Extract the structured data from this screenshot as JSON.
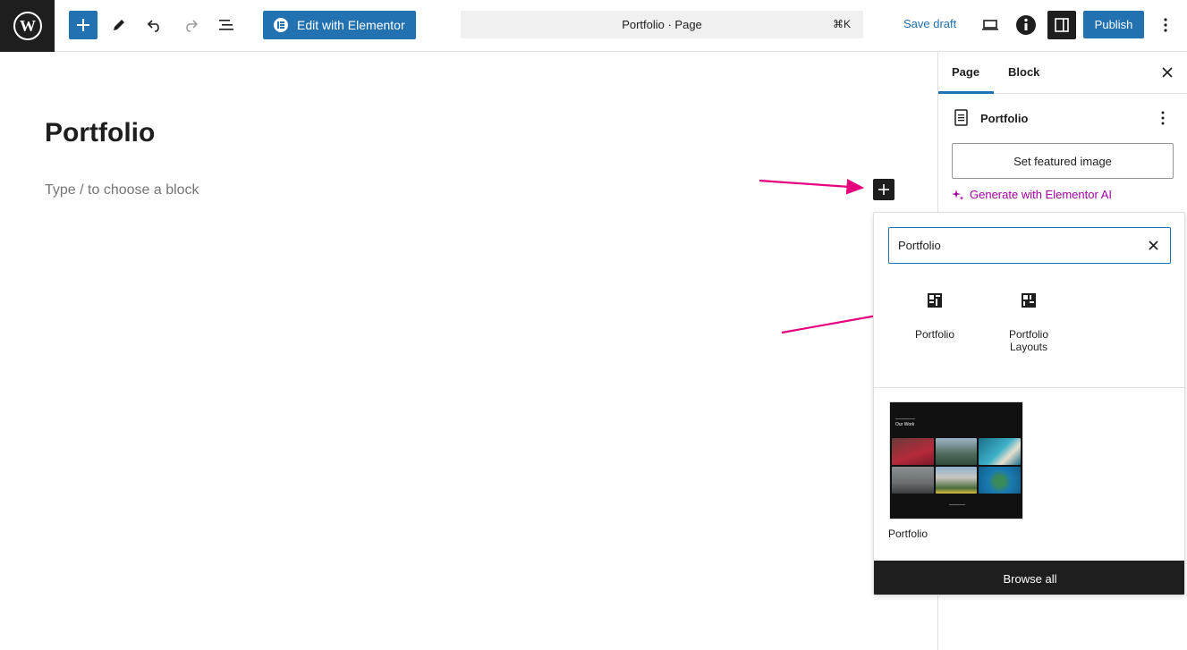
{
  "header": {
    "elementor_label": "Edit with Elementor",
    "doc_title": "Portfolio · Page",
    "shortcut": "⌘K",
    "save_draft": "Save draft",
    "publish": "Publish"
  },
  "editor": {
    "title": "Portfolio",
    "placeholder": "Type / to choose a block"
  },
  "sidebar": {
    "tabs": [
      "Page",
      "Block"
    ],
    "doc_title": "Portfolio",
    "featured_image": "Set featured image",
    "generate_ai": "Generate with Elementor AI"
  },
  "inserter": {
    "search_value": "Portfolio",
    "results": [
      {
        "label": "Portfolio"
      },
      {
        "label": "Portfolio Layouts"
      }
    ],
    "pattern": {
      "label": "Portfolio",
      "thumb_heading": "Our Work"
    },
    "browse_all": "Browse all"
  },
  "colors": {
    "accent": "#2271b1",
    "dark": "#1e1e1e",
    "ai": "#a100a1",
    "arrow": "#e6007e"
  }
}
